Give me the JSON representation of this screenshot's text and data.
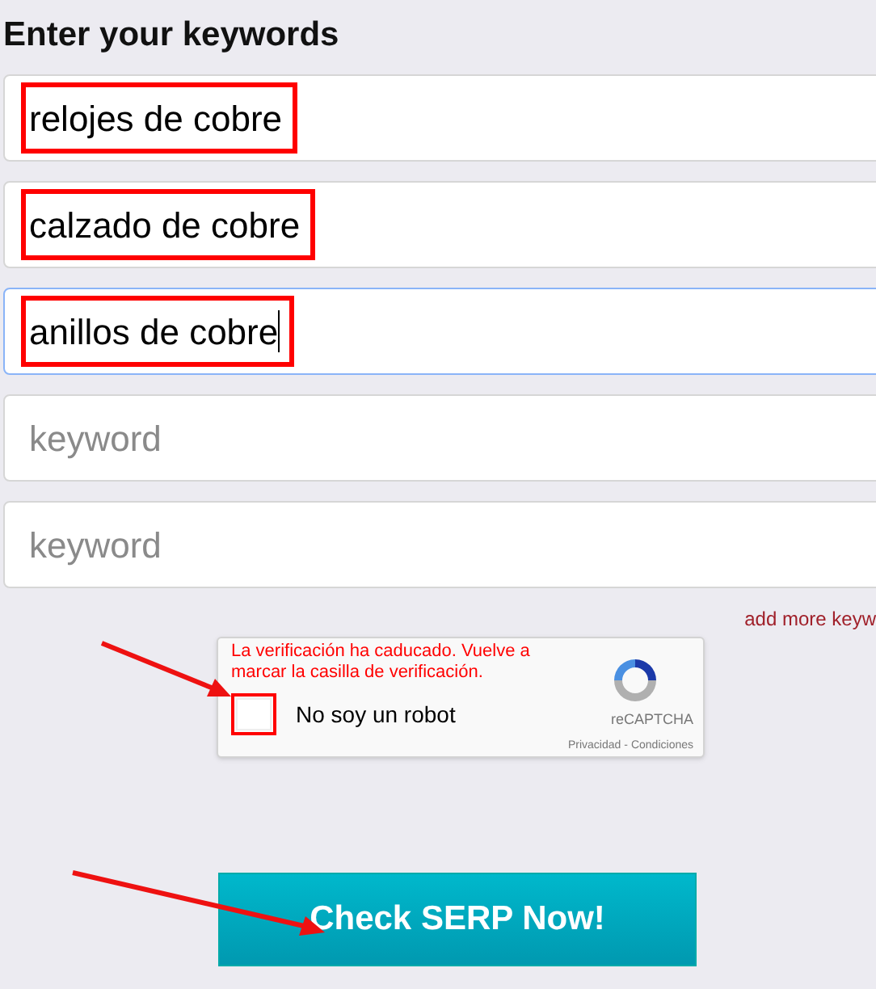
{
  "heading": "Enter your keywords",
  "fields": [
    {
      "value": "relojes de cobre",
      "highlighted": true,
      "focused": false
    },
    {
      "value": "calzado de cobre",
      "highlighted": true,
      "focused": false
    },
    {
      "value": "anillos de cobre",
      "highlighted": true,
      "focused": true
    },
    {
      "placeholder": "keyword",
      "highlighted": false,
      "focused": false
    },
    {
      "placeholder": "keyword",
      "highlighted": false,
      "focused": false
    }
  ],
  "add_more_link": "add more keyw",
  "captcha": {
    "error": "La verificación ha caducado. Vuelve a marcar la casilla de verificación.",
    "label": "No soy un robot",
    "checked": false,
    "highlighted": true,
    "brand": "reCAPTCHA",
    "links": [
      "Privacidad",
      "Condiciones"
    ],
    "separator": "-"
  },
  "submit_button": "Check SERP Now!"
}
